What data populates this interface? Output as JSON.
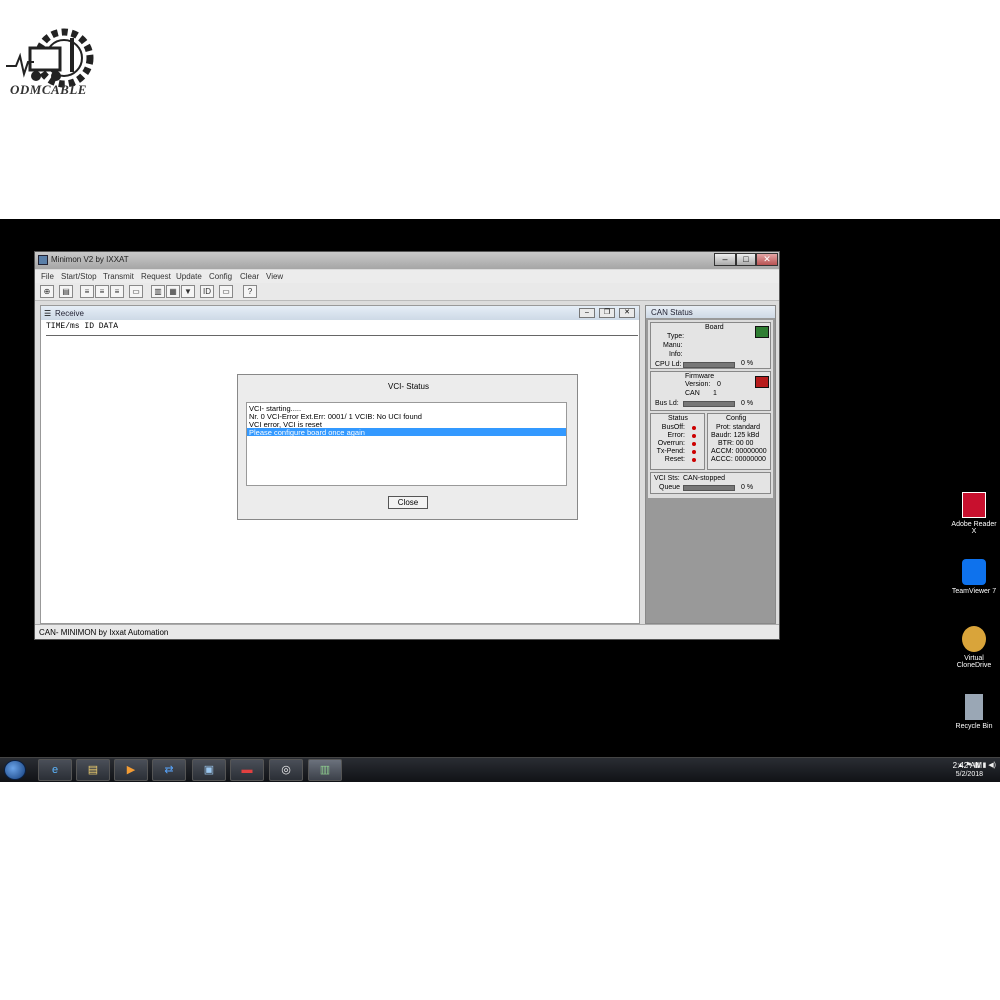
{
  "watermark": {
    "brand": "ODMCABLE"
  },
  "window": {
    "title": "Minimon V2 by IXXAT",
    "menu": [
      "File",
      "Start/Stop",
      "Transmit",
      "Request",
      "Update",
      "Config",
      "Clear",
      "View"
    ],
    "toolbar_help": "?"
  },
  "receive": {
    "title": "Receive",
    "columns": "TIME/ms   ID   DATA"
  },
  "dialog": {
    "title": "VCI- Status",
    "lines": [
      "VCI- starting.....",
      "Nr.  0 VCI-Error Ext.Err: 0001/   1 VCIB: No UCI found",
      "VCI error, VCI is reset",
      "Please configure board once again"
    ],
    "selected_index": 3,
    "close_label": "Close"
  },
  "can_status": {
    "title": "CAN Status",
    "board": {
      "heading": "Board",
      "type_label": "Type:",
      "manu_label": "Manu:",
      "info_label": "Info:",
      "cpu_label": "CPU Ld:",
      "cpu_value": "0 %",
      "cpu_fraction": 0
    },
    "firmware": {
      "heading": "Firmware",
      "version_label": "Version:",
      "version_value": "0",
      "can_label": "CAN",
      "can_value": "1",
      "busld_label": "Bus Ld:",
      "busld_value": "0 %"
    },
    "status": {
      "heading": "Status",
      "items": [
        "BusOff:",
        "Error:",
        "Overrun:",
        "Tx-Pend:",
        "Reset:"
      ]
    },
    "config": {
      "heading": "Config",
      "prot": "Prot:  standard",
      "baudr": "Baudr:   125 kBd",
      "btr": "BTR:   00  00",
      "accm": "ACCM:   00000000",
      "accc": "ACCC:   00000000"
    },
    "vci": {
      "sts_label": "VCI Sts:",
      "sts_value": "CAN-stopped",
      "queue_label": "Queue",
      "queue_value": "0 %"
    }
  },
  "statusbar": {
    "text": "CAN- MINIMON  by  Ixxat Automation"
  },
  "desktop_icons": [
    {
      "label": "Adobe Reader X",
      "icon": "pdf-icon",
      "color": "#c8102e"
    },
    {
      "label": "TeamViewer 7",
      "icon": "teamviewer-icon",
      "color": "#0e72ed"
    },
    {
      "label": "Virtual CloneDrive",
      "icon": "sheep-icon",
      "color": "#d9a43a"
    },
    {
      "label": "Recycle Bin",
      "icon": "recycle-bin-icon",
      "color": "#9aa7b5"
    }
  ],
  "taskbar": {
    "apps": [
      "internet-explorer",
      "file-explorer",
      "media-player",
      "teamviewer",
      "remote-app",
      "toolbox-app",
      "diagnostic-app",
      "ixxat-app"
    ],
    "clock_time": "2:42 AM",
    "clock_date": "5/2/2018"
  }
}
